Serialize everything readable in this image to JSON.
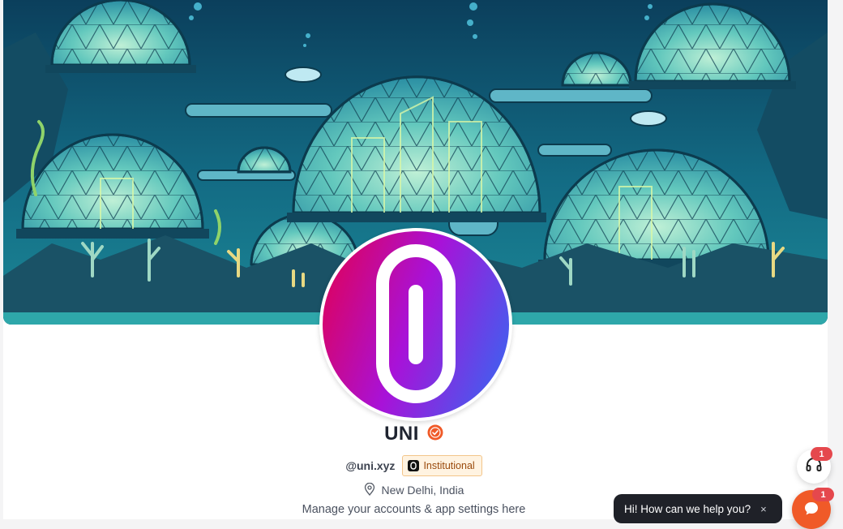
{
  "profile": {
    "name": "UNI",
    "handle": "@uni.xyz",
    "badge_label": "Institutional",
    "location": "New Delhi, India",
    "tagline": "Manage your accounts & app settings here",
    "verified_icon": "check-badge-icon"
  },
  "support": {
    "count": "1",
    "icon": "headset-icon"
  },
  "chat": {
    "prompt": "Hi! How can we help you?",
    "close": "×",
    "count": "1",
    "icon": "chat-icon"
  },
  "colors": {
    "accent": "#f05a28",
    "banner_water": "#0f4f6e",
    "avatar_gradient_start": "#e4004f",
    "avatar_gradient_end": "#2f6cf3",
    "notification": "#e5484d"
  }
}
